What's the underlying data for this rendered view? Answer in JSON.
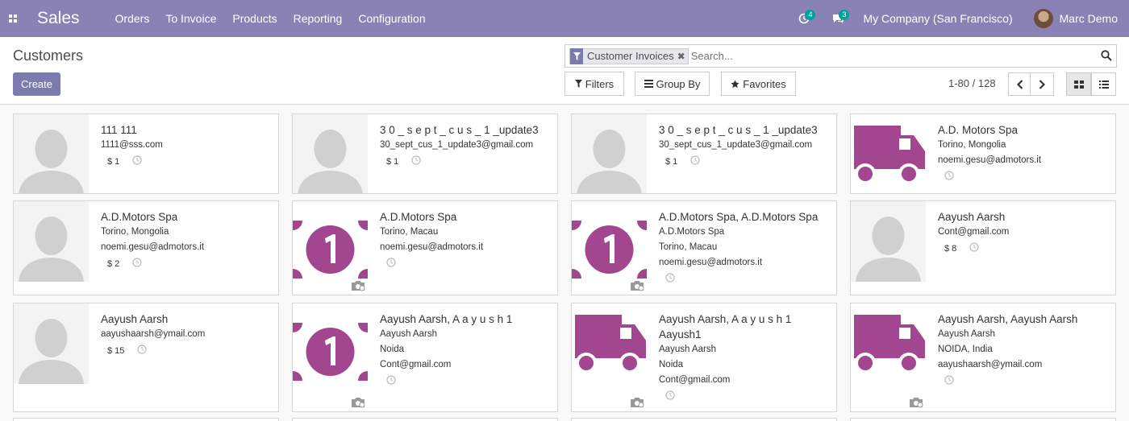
{
  "navbar": {
    "app_name": "Sales",
    "menu": [
      "Orders",
      "To Invoice",
      "Products",
      "Reporting",
      "Configuration"
    ],
    "activity_count": "4",
    "message_count": "3",
    "company": "My Company (San Francisco)",
    "user": "Marc Demo"
  },
  "control": {
    "title": "Customers",
    "create_label": "Create",
    "facet_label": "Customer Invoices",
    "search_placeholder": "Search...",
    "filters_label": "Filters",
    "groupby_label": "Group By",
    "favorites_label": "Favorites",
    "pager": "1-80 / 128"
  },
  "colors": {
    "navbar": "#8a82b4",
    "accent": "#7c7bad",
    "image_purple": "#a1468f",
    "placeholder_gray": "#d0d0d0"
  },
  "cards": [
    {
      "name": "111 111",
      "lines": [
        "1111@sss.com"
      ],
      "amount": "$ 1",
      "image": "person"
    },
    {
      "name": "3 0 _ s e p t _ c u s _ 1 _update3",
      "lines": [
        "30_sept_cus_1_update3@gmail.com"
      ],
      "amount": "$ 1",
      "image": "person"
    },
    {
      "name": "3 0 _ s e p t _ c u s _ 1 _update3",
      "lines": [
        "30_sept_cus_1_update3@gmail.com"
      ],
      "amount": "$ 1",
      "image": "person"
    },
    {
      "name": "A.D. Motors Spa",
      "lines": [
        "Torino, Mongolia",
        "noemi.gesu@admotors.it"
      ],
      "amount": "",
      "image": "truck"
    },
    {
      "name": "A.D.Motors Spa",
      "lines": [
        "Torino, Mongolia",
        "noemi.gesu@admotors.it"
      ],
      "amount": "$ 2",
      "image": "person"
    },
    {
      "name": "A.D.Motors Spa",
      "lines": [
        "Torino, Macau",
        "noemi.gesu@admotors.it"
      ],
      "amount": "",
      "image": "money"
    },
    {
      "name": "A.D.Motors Spa, A.D.Motors Spa",
      "lines": [
        "A.D.Motors Spa",
        "Torino, Macau",
        "noemi.gesu@admotors.it"
      ],
      "amount": "",
      "image": "money"
    },
    {
      "name": "Aayush Aarsh",
      "lines": [
        "Cont@gmail.com"
      ],
      "amount": "$ 8",
      "image": "person"
    },
    {
      "name": "Aayush Aarsh",
      "lines": [
        "aayushaarsh@ymail.com"
      ],
      "amount": "$ 15",
      "image": "person"
    },
    {
      "name": "Aayush Aarsh, A a y u s h 1",
      "lines": [
        "Aayush Aarsh",
        "Noida",
        "Cont@gmail.com"
      ],
      "amount": "",
      "image": "money"
    },
    {
      "name": "Aayush Aarsh, A a y u s h 1 Aayush1",
      "lines": [
        "Aayush Aarsh",
        "Noida",
        "Cont@gmail.com"
      ],
      "amount": "",
      "image": "truck"
    },
    {
      "name": "Aayush Aarsh, Aayush Aarsh",
      "lines": [
        "Aayush Aarsh",
        "NOIDA, India",
        "aayushaarsh@ymail.com"
      ],
      "amount": "",
      "image": "truck"
    }
  ]
}
